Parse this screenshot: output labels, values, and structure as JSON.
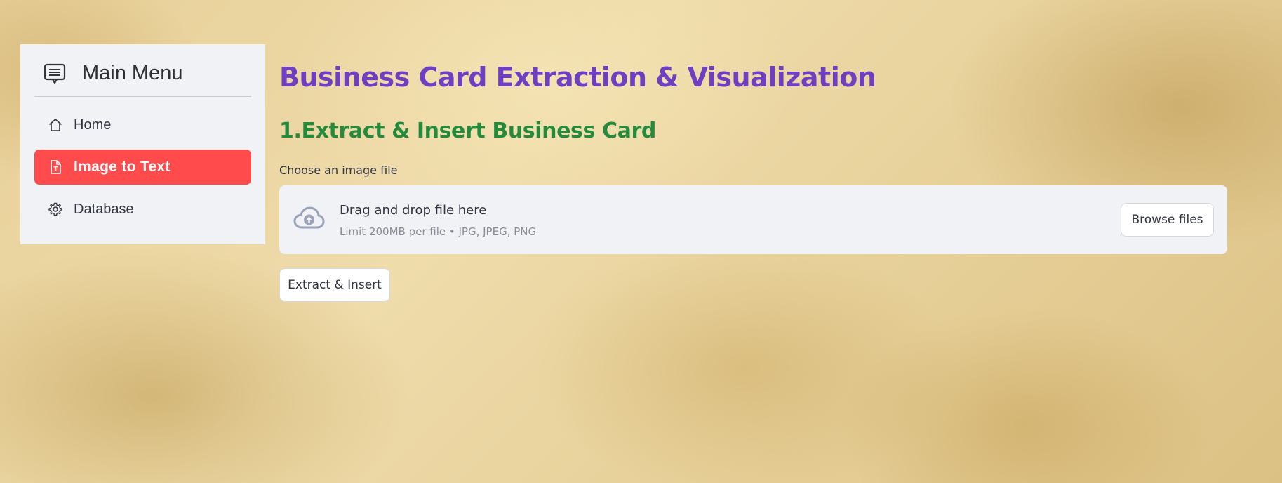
{
  "sidebar": {
    "title": "Main Menu",
    "title_icon": "menu-list-icon",
    "items": [
      {
        "label": "Home",
        "icon": "house-icon",
        "active": false
      },
      {
        "label": "Image to Text",
        "icon": "text-file-icon",
        "active": true
      },
      {
        "label": "Database",
        "icon": "gear-icon",
        "active": false
      }
    ],
    "active_color": "#ff4b4b"
  },
  "main": {
    "title": "Business Card Extraction & Visualization",
    "title_color": "#6f3fc2",
    "section_title": "1.Extract & Insert Business Card",
    "section_color": "#268a3c",
    "uploader": {
      "label": "Choose an image file",
      "drop_text": "Drag and drop file here",
      "limit_text": "Limit 200MB per file • JPG, JPEG, PNG",
      "icon": "cloud-upload-icon",
      "browse_label": "Browse files"
    },
    "extract_button_label": "Extract & Insert"
  }
}
